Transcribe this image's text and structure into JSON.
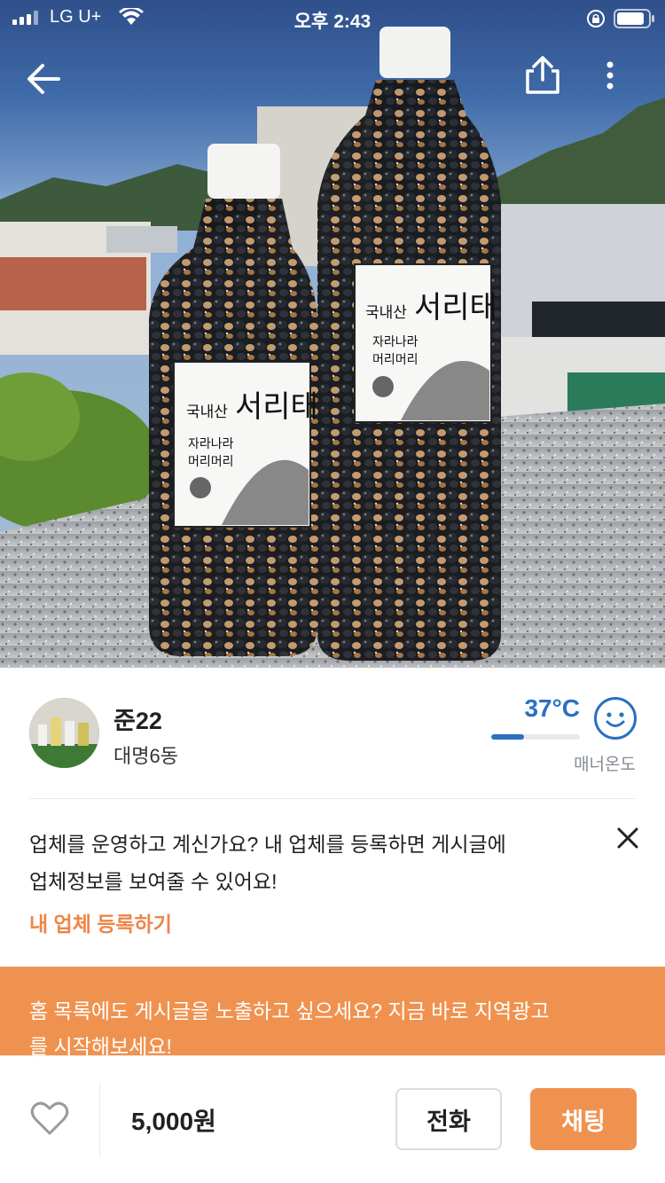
{
  "status_bar": {
    "carrier": "LG U+",
    "time": "오후 2:43"
  },
  "nav": {
    "back_icon": "arrow-left-icon",
    "share_icon": "share-icon",
    "more_icon": "more-vertical-icon"
  },
  "photo": {
    "label_small_bottle": {
      "line1": "국내산",
      "line2": "서리태",
      "line3": "자라나라",
      "line4": "머리머리"
    },
    "label_large_bottle": {
      "line1": "국내산",
      "line2": "서리태",
      "line3": "자라나라",
      "line4": "머리머리"
    }
  },
  "seller": {
    "name": "준22",
    "region": "대명6동",
    "temperature": "37°C",
    "temperature_level_percent": 37,
    "manner_label": "매너온도",
    "accent_color": "#2c6fc3"
  },
  "business_notice": {
    "line1": "업체를 운영하고 계신가요? 내 업체를 등록하면 게시글에",
    "line2": "업체정보를 보여줄 수 있어요!",
    "link": "내 업체 등록하기",
    "link_color": "#ee8548"
  },
  "ad_banner": {
    "line1": "홈 목록에도 게시글을 노출하고 싶으세요? 지금 바로 지역광고",
    "line2": "를 시작해보세요!",
    "background": "#f0924f"
  },
  "bottom_bar": {
    "price": "5,000원",
    "call_label": "전화",
    "chat_label": "채팅",
    "chat_color": "#f0924f"
  }
}
